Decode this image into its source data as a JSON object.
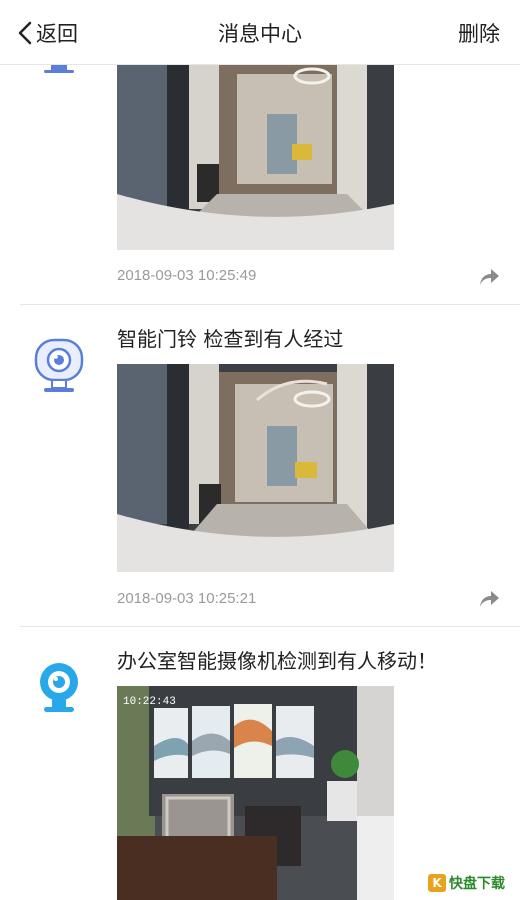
{
  "nav": {
    "back_label": "返回",
    "title": "消息中心",
    "delete_label": "删除"
  },
  "messages": [
    {
      "title": "",
      "timestamp": "2018-09-03 10:25:49",
      "device_icon": "doorbell-camera-icon"
    },
    {
      "title": "智能门铃 检查到有人经过",
      "timestamp": "2018-09-03 10:25:21",
      "device_icon": "doorbell-camera-icon"
    },
    {
      "title": "办公室智能摄像机检测到有人移动！",
      "timestamp": "",
      "device_icon": "office-camera-icon",
      "overlay_time": "10:22:43"
    }
  ],
  "colors": {
    "doorbell_icon": "#5b7fd8",
    "office_icon": "#28a8e8",
    "timestamp": "#9a9a9a",
    "divider": "#e6e6e6"
  },
  "watermark": {
    "badge": "K",
    "text": "快盘下载"
  }
}
